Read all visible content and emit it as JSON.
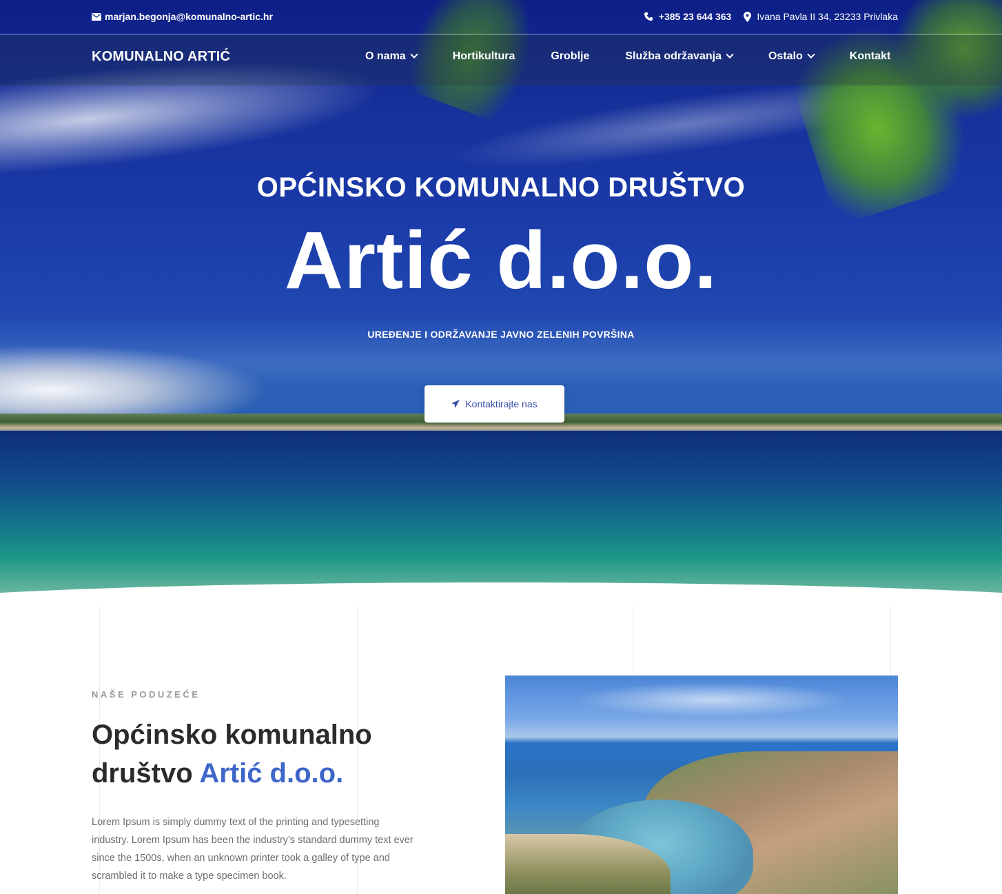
{
  "topbar": {
    "email": "marjan.begonja@komunalno-artic.hr",
    "phone": "+385 23 644 363",
    "address": "Ivana Pavla II 34, 23233 Privlaka"
  },
  "nav": {
    "brand": "KOMUNALNO ARTIĆ",
    "items": [
      {
        "label": "O nama",
        "dropdown": true
      },
      {
        "label": "Hortikultura",
        "dropdown": false
      },
      {
        "label": "Groblje",
        "dropdown": false
      },
      {
        "label": "Služba održavanja",
        "dropdown": true
      },
      {
        "label": "Ostalo",
        "dropdown": true
      },
      {
        "label": "Kontakt",
        "dropdown": false
      }
    ]
  },
  "hero": {
    "subtitle": "OPĆINSKO KOMUNALNO DRUŠTVO",
    "title": "Artić d.o.o.",
    "tagline": "UREĐENJE I ODRŽAVANJE JAVNO ZELENIH POVRŠINA",
    "cta_label": "Kontaktirajte nas"
  },
  "about": {
    "eyebrow": "NAŠE PODUZEĆE",
    "title_line1": "Općinsko komunalno",
    "title_line2_plain": "društvo ",
    "title_line2_accent": "Artić d.o.o.",
    "body": "Lorem Ipsum is simply dummy text of the printing and typesetting industry. Lorem Ipsum has been the industry's standard dummy text ever since the 1500s, when an unknown printer took a galley of type and scrambled it to make a type specimen book."
  },
  "colors": {
    "accent": "#3e66c8",
    "button_text": "#3a4fa8",
    "eyebrow": "#9a9a9a",
    "heading": "#2b2b2b",
    "body_text": "#6d6d6d"
  },
  "icons": {
    "email": "envelope-icon",
    "phone": "phone-icon",
    "address": "map-pin-icon",
    "cta": "paper-plane-icon",
    "dropdown": "chevron-down-icon"
  }
}
